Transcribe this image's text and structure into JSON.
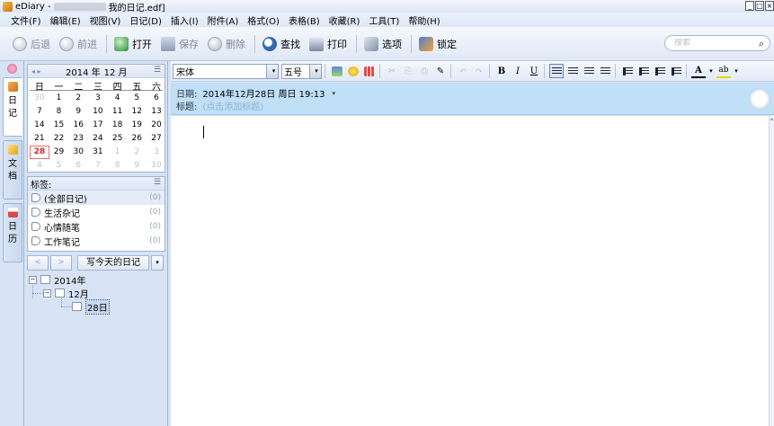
{
  "window": {
    "app_name": "eDiary -",
    "file_name": "我的日记.edf]",
    "buttons": [
      "_",
      "□",
      "×"
    ]
  },
  "menu": [
    "文件(F)",
    "编辑(E)",
    "视图(V)",
    "日记(D)",
    "插入(I)",
    "附件(A)",
    "格式(O)",
    "表格(B)",
    "收藏(R)",
    "工具(T)",
    "帮助(H)"
  ],
  "toolbar": {
    "back": "后退",
    "forward": "前进",
    "open": "打开",
    "save": "保存",
    "delete": "删除",
    "find": "查找",
    "print": "打印",
    "options": "选项",
    "lock": "锁定"
  },
  "search": {
    "placeholder": "搜索",
    "icon": "magnifier-icon"
  },
  "sidetabs": [
    {
      "label": "日记",
      "icon": "diary-icon"
    },
    {
      "label": "文档",
      "icon": "document-icon"
    },
    {
      "label": "日历",
      "icon": "calendar-icon"
    }
  ],
  "calendar": {
    "nav": "◂ ▸",
    "year": "2014 年",
    "month": "12 月",
    "menu": "☰",
    "weekdays": [
      "日",
      "一",
      "二",
      "三",
      "四",
      "五",
      "六"
    ],
    "days": [
      "30",
      "1",
      "2",
      "3",
      "4",
      "5",
      "6",
      "7",
      "8",
      "9",
      "10",
      "11",
      "12",
      "13",
      "14",
      "15",
      "16",
      "17",
      "18",
      "19",
      "20",
      "21",
      "22",
      "23",
      "24",
      "25",
      "26",
      "27",
      "28",
      "29",
      "30",
      "31",
      "1",
      "2",
      "3",
      "4",
      "5",
      "6",
      "7",
      "8",
      "9",
      "10"
    ],
    "other_month_index": [
      0,
      32,
      33,
      34,
      35,
      36,
      37,
      38,
      39,
      40,
      41
    ],
    "today_index": 28
  },
  "tags": {
    "title": "标签:",
    "menu": "☰",
    "items": [
      {
        "name": "(全部日记)",
        "count": "(0)"
      },
      {
        "name": "生活杂记",
        "count": "(0)"
      },
      {
        "name": "心情随笔",
        "count": "(0)"
      },
      {
        "name": "工作笔记",
        "count": "(0)"
      }
    ]
  },
  "nav": {
    "prev": "<",
    "next": ">",
    "write_today": "写今天的日记",
    "drop": "▾"
  },
  "tree": {
    "year": "2014年",
    "month": "12月",
    "day": "28日",
    "collapse": "−"
  },
  "format": {
    "font": "宋体",
    "size": "五号",
    "dropdown": "▾",
    "bold": "B",
    "italic": "I",
    "underline": "U",
    "font_color": "A",
    "highlight": "ab"
  },
  "meta": {
    "date_label": "日期:",
    "date_value": "2014年12月28日  周日 19:13",
    "caret": "▾",
    "title_label": "标题:",
    "title_placeholder": "(点击添加标题)"
  },
  "scroll": {
    "up": "▴"
  }
}
